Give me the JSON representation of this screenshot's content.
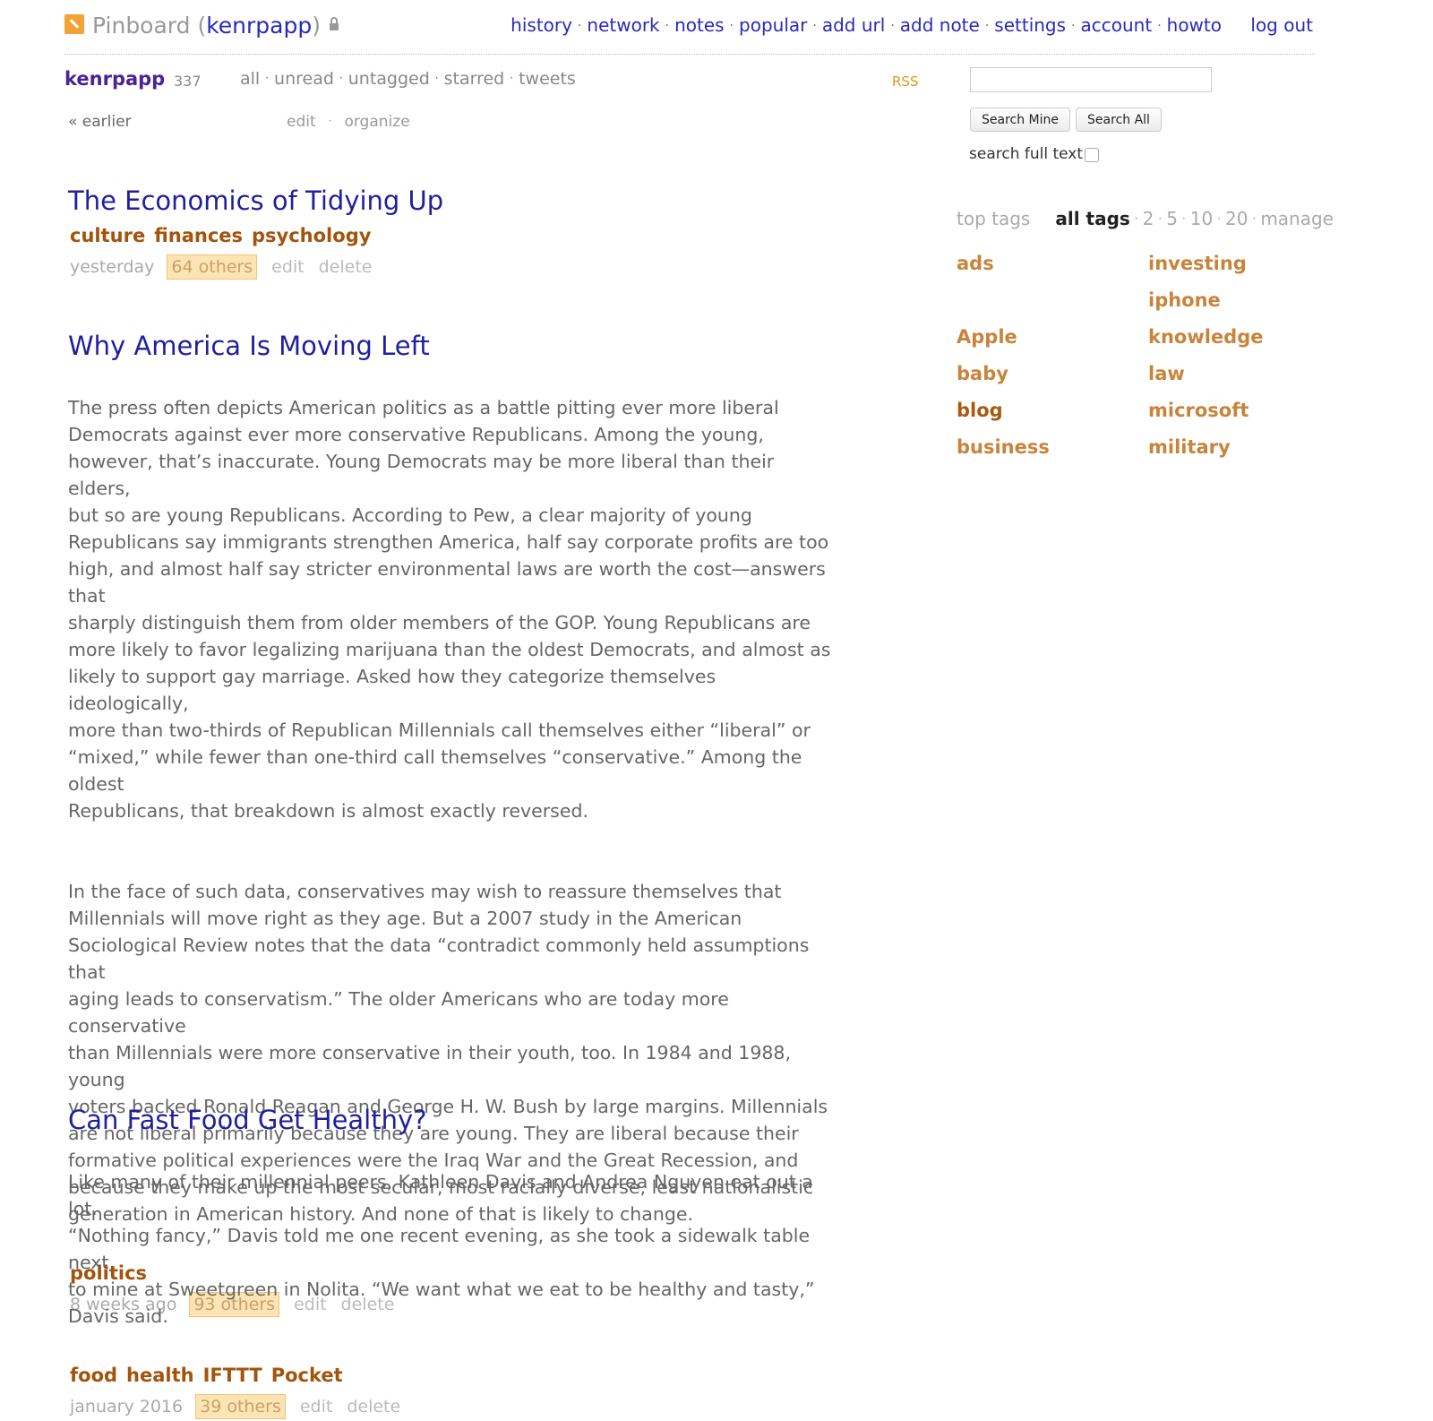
{
  "header": {
    "app_name": "Pinboard",
    "username": "kenrpapp",
    "nav": [
      "history",
      "network",
      "notes",
      "popular",
      "add url",
      "add note",
      "settings",
      "account",
      "howto"
    ],
    "logout": "log out"
  },
  "subheader": {
    "username": "kenrpapp",
    "count": "337",
    "filters": [
      "all",
      "unread",
      "untagged",
      "starred",
      "tweets"
    ],
    "rss": "RSS",
    "earlier": "« earlier",
    "edit": "edit",
    "organize": "organize"
  },
  "search": {
    "value": "",
    "search_mine": "Search Mine",
    "search_all": "Search All",
    "full_text_label": "search full text",
    "full_text_checked": false
  },
  "tags_panel": {
    "top_tags": "top tags",
    "all_tags": "all tags",
    "counts": [
      "2",
      "5",
      "10",
      "20"
    ],
    "manage": "manage",
    "left_column": [
      "ads",
      "",
      "Apple",
      "baby",
      "blog",
      "business"
    ],
    "right_column": [
      "investing",
      "iphone",
      "knowledge",
      "law",
      "microsoft",
      "military"
    ]
  },
  "bookmarks": [
    {
      "title": "The Economics of Tidying Up",
      "description": [],
      "tags": [
        "culture",
        "finances",
        "psychology"
      ],
      "when": "yesterday",
      "others": "64 others",
      "edit": "edit",
      "delete": "delete"
    },
    {
      "title": "Why America Is Moving Left",
      "description": [
        "The press often depicts American politics as a battle pitting ever more liberal\nDemocrats against ever more conservative Republicans. Among the young,\nhowever, that’s inaccurate. Young Democrats may be more liberal than their elders,\nbut so are young Republicans. According to Pew, a clear majority of young\nRepublicans say immigrants strengthen America, half say corporate profits are too\nhigh, and almost half say stricter environmental laws are worth the cost—answers that\nsharply distinguish them from older members of the GOP. Young Republicans are\nmore likely to favor legalizing marijuana than the oldest Democrats, and almost as\nlikely to support gay marriage. Asked how they categorize themselves ideologically,\nmore than two-thirds of Republican Millennials call themselves either “liberal” or\n“mixed,” while fewer than one-third call themselves “conservative.” Among the oldest\nRepublicans, that breakdown is almost exactly reversed.",
        "In the face of such data, conservatives may wish to reassure themselves that\nMillennials will move right as they age. But a 2007 study in the American\nSociological Review notes that the data “contradict commonly held assumptions that\naging leads to conservatism.” The older Americans who are today more conservative\nthan Millennials were more conservative in their youth, too. In 1984 and 1988, young\nvoters backed Ronald Reagan and George H. W. Bush by large margins. Millennials\nare not liberal primarily because they are young. They are liberal because their\nformative political experiences were the Iraq War and the Great Recession, and\nbecause they make up the most secular, most racially diverse, least nationalistic\ngeneration in American history. And none of that is likely to change."
      ],
      "tags": [
        "politics"
      ],
      "when": "8 weeks ago",
      "others": "93 others",
      "edit": "edit",
      "delete": "delete"
    },
    {
      "title": "Can Fast Food Get Healthy?",
      "description": [
        "Like many of their millennial peers, Kathleen Davis and Andrea Nguyen eat out a lot.\n“Nothing fancy,” Davis told me one recent evening, as she took a sidewalk table next\nto mine at Sweetgreen in Nolita. “We want what we eat to be healthy and tasty,”\nDavis said."
      ],
      "tags": [
        "food",
        "health",
        "IFTTT",
        "Pocket"
      ],
      "when": "january 2016",
      "others": "39 others",
      "edit": "edit",
      "delete": "delete"
    }
  ],
  "colors": {
    "link_blue": "#1f1fa0",
    "username_purple": "#4b2299",
    "tag_brown": "#a3540c",
    "tag_cloud": "#c8843b",
    "others_highlight": "#fde4b4",
    "rss_orange": "#e2961a"
  }
}
